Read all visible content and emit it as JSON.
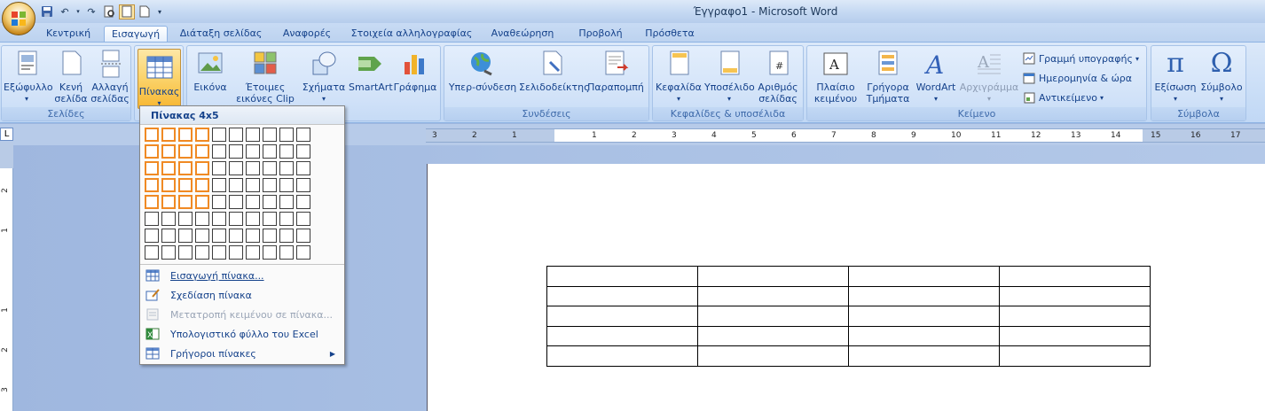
{
  "window": {
    "title": "Έγγραφο1 - Microsoft Word"
  },
  "tabs": [
    {
      "label": "Κεντρική"
    },
    {
      "label": "Εισαγωγή",
      "active": true
    },
    {
      "label": "Διάταξη σελίδας"
    },
    {
      "label": "Αναφορές"
    },
    {
      "label": "Στοιχεία αλληλογραφίας"
    },
    {
      "label": "Αναθεώρηση"
    },
    {
      "label": "Προβολή"
    },
    {
      "label": "Πρόσθετα"
    }
  ],
  "ribbon": {
    "pages": {
      "label": "Σελίδες",
      "cover": "Εξώφυλλο",
      "blank1": "Κενή",
      "blank2": "σελίδα",
      "break1": "Αλλαγή",
      "break2": "σελίδας"
    },
    "tables": {
      "table": "Πίνακας"
    },
    "illustrations": {
      "picture": "Εικόνα",
      "clipart1": "Έτοιμες",
      "clipart2": "εικόνες Clip Art",
      "shapes": "Σχήματα",
      "smartart": "SmartArt",
      "chart": "Γράφημα"
    },
    "links": {
      "label": "Συνδέσεις",
      "hyperlink": "Υπερ-σύνδεση",
      "bookmark": "Σελιδοδείκτης",
      "crossref": "Παραπομπή"
    },
    "headerfooter": {
      "label": "Κεφαλίδες & υποσέλιδα",
      "header": "Κεφαλίδα",
      "footer": "Υποσέλιδο",
      "pagenum1": "Αριθμός",
      "pagenum2": "σελίδας"
    },
    "text": {
      "label": "Κείμενο",
      "textbox1": "Πλαίσιο",
      "textbox2": "κειμένου",
      "quickparts1": "Γρήγορα",
      "quickparts2": "Τμήματα",
      "wordart": "WordArt",
      "dropcap": "Αρχιγράμμα",
      "signature": "Γραμμή υπογραφής",
      "datetime": "Ημερομηνία & ώρα",
      "object": "Αντικείμενο"
    },
    "symbols": {
      "label": "Σύμβολα",
      "equation": "Εξίσωση",
      "symbol": "Σύμβολο"
    }
  },
  "dropdown": {
    "title": "Πίνακας 4x5",
    "grid": {
      "cols": 10,
      "rows": 8,
      "sel_cols": 4,
      "sel_rows": 5
    },
    "items": [
      {
        "label": "Εισαγωγή πίνακα...",
        "enabled": true
      },
      {
        "label": "Σχεδίαση πίνακα",
        "enabled": true
      },
      {
        "label": "Μετατροπή κειμένου σε πίνακα...",
        "enabled": false
      },
      {
        "label": "Υπολογιστικό φύλλο του Excel",
        "enabled": true
      },
      {
        "label": "Γρήγοροι πίνακες",
        "enabled": true,
        "submenu": true
      }
    ]
  },
  "ruler": {
    "h_ticks": [
      "3",
      "2",
      "1",
      "1",
      "2",
      "3",
      "4",
      "5",
      "6",
      "7",
      "8",
      "9",
      "10",
      "11",
      "12",
      "13",
      "14",
      "15",
      "16",
      "17"
    ],
    "v_ticks": [
      "2",
      "1",
      "1",
      "2",
      "3"
    ]
  },
  "document": {
    "table": {
      "rows": 5,
      "cols": 4
    }
  }
}
